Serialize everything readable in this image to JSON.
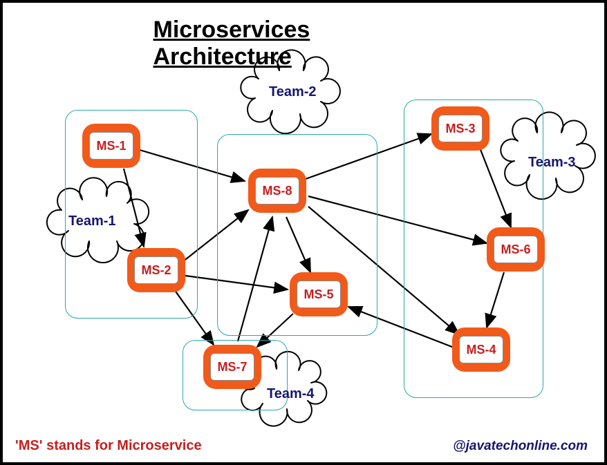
{
  "title": "Microservices Architecture",
  "footer_left": "'MS' stands for Microservice",
  "footer_right": "@javatechonline.com",
  "teams": {
    "team1": "Team-1",
    "team2": "Team-2",
    "team3": "Team-3",
    "team4": "Team-4"
  },
  "nodes": {
    "ms1": "MS-1",
    "ms2": "MS-2",
    "ms3": "MS-3",
    "ms4": "MS-4",
    "ms5": "MS-5",
    "ms6": "MS-6",
    "ms7": "MS-7",
    "ms8": "MS-8"
  },
  "edges": [
    [
      "ms1",
      "ms2"
    ],
    [
      "ms1",
      "ms8"
    ],
    [
      "ms2",
      "ms7"
    ],
    [
      "ms2",
      "ms8"
    ],
    [
      "ms2",
      "ms5"
    ],
    [
      "ms7",
      "ms8"
    ],
    [
      "ms8",
      "ms3"
    ],
    [
      "ms8",
      "ms5"
    ],
    [
      "ms8",
      "ms6"
    ],
    [
      "ms8",
      "ms4"
    ],
    [
      "ms3",
      "ms6"
    ],
    [
      "ms6",
      "ms4"
    ],
    [
      "ms4",
      "ms5"
    ],
    [
      "ms5",
      "ms7"
    ]
  ]
}
